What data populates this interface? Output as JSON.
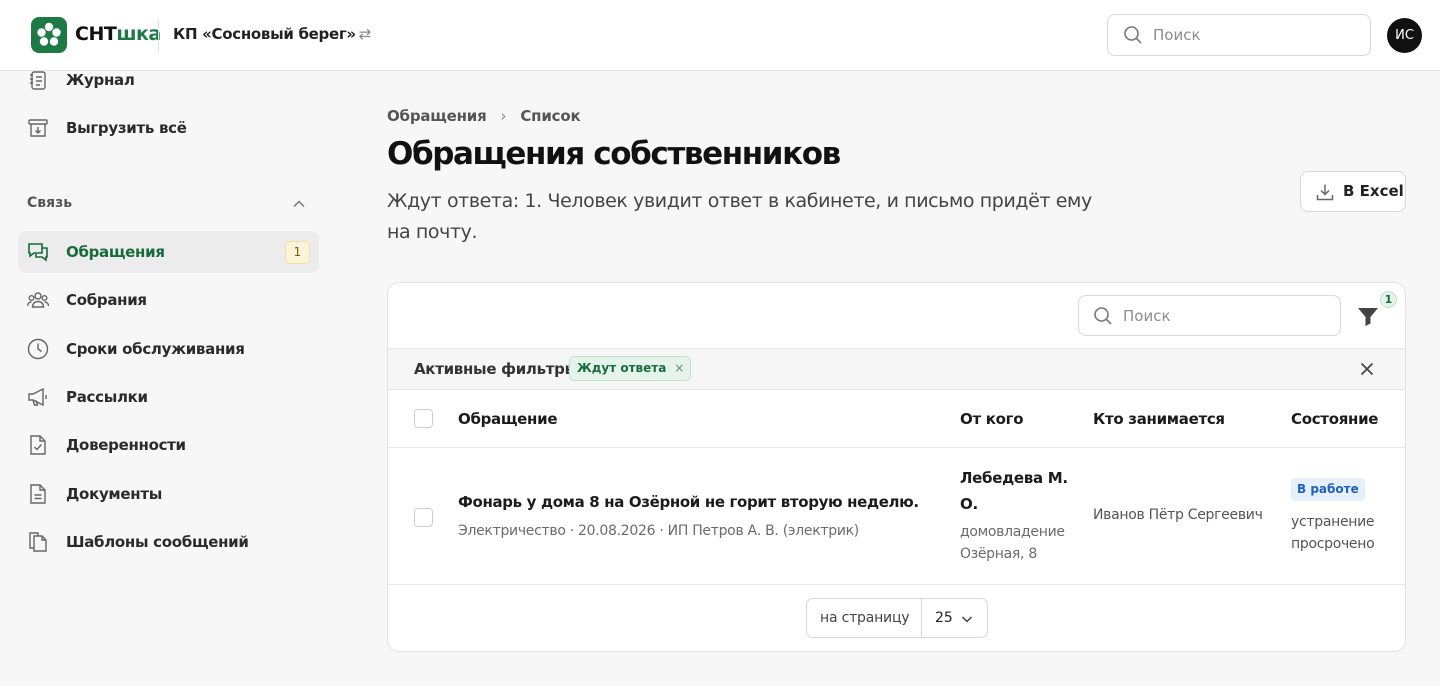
{
  "header": {
    "brand_part1": "СНТ",
    "brand_part2": "шка",
    "org_name": "КП «Сосновый берег»",
    "org_switch_icon": "⇄",
    "search_placeholder": "Поиск",
    "avatar_initials": "ИС"
  },
  "sidebar": {
    "top_items": [
      {
        "label": "Журнал",
        "icon": "journal-icon"
      },
      {
        "label": "Выгрузить всё",
        "icon": "archive-download-icon"
      }
    ],
    "section_title": "Связь",
    "items": [
      {
        "label": "Обращения",
        "icon": "chat-icon",
        "active": true,
        "badge": "1"
      },
      {
        "label": "Собрания",
        "icon": "people-icon"
      },
      {
        "label": "Сроки обслуживания",
        "icon": "clock-icon"
      },
      {
        "label": "Рассылки",
        "icon": "megaphone-icon"
      },
      {
        "label": "Доверенности",
        "icon": "document-check-icon"
      },
      {
        "label": "Документы",
        "icon": "document-icon"
      },
      {
        "label": "Шаблоны сообщений",
        "icon": "copy-icon"
      }
    ]
  },
  "main": {
    "breadcrumb": [
      "Обращения",
      "Список"
    ],
    "breadcrumb_sep": "›",
    "title": "Обращения собственников",
    "subtitle": "Ждут ответа: 1. Человек увидит ответ в кабинете, и письмо придёт ему на почту.",
    "export_label": "В Excel"
  },
  "table": {
    "search_placeholder": "Поиск",
    "filter_count": "1",
    "active_filters_label": "Активные фильтры",
    "filter_chips": [
      {
        "label": "Ждут ответа",
        "remove": "×"
      }
    ],
    "columns": [
      "Обращение",
      "От кого",
      "Кто занимается",
      "Состояние"
    ],
    "rows": [
      {
        "title": "Фонарь у дома 8 на Озёрной не горит вторую неделю.",
        "meta": "Электричество · 20.08.2026 · ИП Петров А. В. (электрик)",
        "from_name": "Лебедева М. О.",
        "from_address": "домовладение Озёрная, 8",
        "assignee": "Иванов Пётр Сергеевич",
        "status": "В работе",
        "status_note": "устранение просрочено"
      }
    ],
    "per_page_label": "на страницу",
    "per_page_value": "25"
  },
  "colors": {
    "brand_green": "#1d7a45",
    "active_text": "#176b3d",
    "status_blue": "#1f5fbf",
    "badge_yellow": "#fdf3d9"
  }
}
